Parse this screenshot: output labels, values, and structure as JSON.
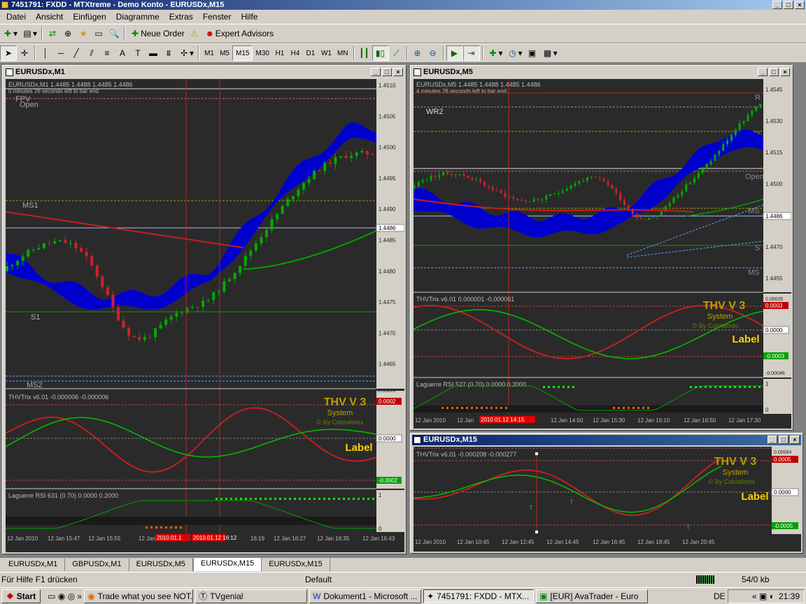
{
  "app": {
    "title": "7451791: FXDD - MTXtreme - Demo Konto - EURUSDx,M15"
  },
  "menu": [
    "Datei",
    "Ansicht",
    "Einfügen",
    "Diagramme",
    "Extras",
    "Fenster",
    "Hilfe"
  ],
  "toolbar1": {
    "new_order": "Neue Order",
    "expert_advisors": "Expert Advisors"
  },
  "timeframes": [
    "M1",
    "M5",
    "M15",
    "M30",
    "H1",
    "H4",
    "D1",
    "W1",
    "MN"
  ],
  "active_timeframe": "M15",
  "colors": {
    "bg": "#2a2a2a",
    "bull": "#00aa00",
    "bear": "#cc2030",
    "cloud": "#0000cc",
    "ma_red": "#c02020",
    "ma_green": "#00a000",
    "thv_title": "#b8a000",
    "label": "#ffd000"
  },
  "windows": {
    "m1": {
      "title": "EURUSDx,M1",
      "header": "EURUSDx,M1  1.4485 1.4488 1.4485 1.4486",
      "timer": "0 minutes 26 seconds left to bar end",
      "levels": [
        "FPV",
        "Open",
        "MS1",
        "S1",
        "MS2"
      ],
      "price_ticks": [
        "1.4510",
        "1.4505",
        "1.4500",
        "1.4495",
        "1.4490",
        "1.4485",
        "1.4480",
        "1.4475",
        "1.4470",
        "1.4465"
      ],
      "current_price": "1.4486",
      "thv_header": "THVTrix v6.01 -0.000006 -0.000006",
      "thv_brand": {
        "title": "THV V 3",
        "system": "System",
        "by": "© By Cobraforex",
        "label": "Label"
      },
      "thv_ticks": [
        "0.0002",
        "0.0000",
        "-0.0002"
      ],
      "thv_scale": "0.00018",
      "rsi_header": "Laguerre RSI 631 (0.70) 0.0000 0.2000",
      "rsi_ticks": [
        "1",
        "0"
      ],
      "time_labels": [
        "12 Jan 2010",
        "12 Jan 15:47",
        "12 Jan 15:55",
        "12 Jan",
        "2010.01.1",
        "2010.01.12 16:12",
        "16:19",
        "12 Jan 16:27",
        "12 Jan 16:35",
        "12 Jan 16:43"
      ]
    },
    "m5": {
      "title": "EURUSDx,M5",
      "header": "EURUSDx,M5  1.4485 1.4488 1.4485 1.4486",
      "timer": "4 minutes 26 seconds left to bar end",
      "levels": [
        "WR2",
        "R",
        "MR",
        "Open",
        "MS",
        "S",
        "MS"
      ],
      "price_ticks": [
        "1.4545",
        "1.4530",
        "1.4515",
        "1.4500",
        "1.4485",
        "1.4470",
        "1.4455"
      ],
      "current_price": "1.4486",
      "thv_header": "THVTrix v6.01 0.000001 -0.000061",
      "thv_brand": {
        "title": "THV V 3",
        "system": "System",
        "by": "© By Cobraforex",
        "label": "Label"
      },
      "thv_ticks": [
        "0.00035",
        "0.0003",
        "0.0000",
        "-0.0003",
        "-0.00046"
      ],
      "rsi_header": "Laguerre RSI 527 (0.70) 0.0000 0.2000",
      "rsi_ticks": [
        "1",
        "0"
      ],
      "time_labels": [
        "12 Jan 2010",
        "12 Jan",
        "2010.01.12 14:15",
        "12 Jan 14:50",
        "12 Jan 15:30",
        "12 Jan 16:10",
        "12 Jan 16:50",
        "12 Jan 17:30"
      ]
    },
    "m15": {
      "title": "EURUSDx,M15",
      "thv_header": "THVTrix v6.01 -0.000208 -0.000277",
      "thv_brand": {
        "title": "THV V 3",
        "system": "System",
        "by": "© By Cobraforex",
        "label": "Label"
      },
      "thv_ticks": [
        "0.00064",
        "0.0005",
        "0.0000",
        "-0.0005"
      ],
      "time_labels": [
        "12 Jan 2010",
        "12 Jan 10:45",
        "12 Jan 12:45",
        "12 Jan 14:45",
        "12 Jan 16:45",
        "12 Jan 18:45",
        "12 Jan 20:45"
      ]
    }
  },
  "tabs": [
    "EURUSDx,M1",
    "GBPUSDx,M1",
    "EURUSDx,M5",
    "EURUSDx,M15",
    "EURUSDx,M15"
  ],
  "active_tab": 3,
  "status": {
    "help": "Für Hilfe F1 drücken",
    "profile": "Default",
    "traffic": "54/0 kb"
  },
  "taskbar": {
    "start": "Start",
    "items": [
      "Trade what you see NOT...",
      "TVgenial",
      "Dokument1 - Microsoft ...",
      "7451791: FXDD - MTX...",
      "[EUR] AvaTrader - Euro"
    ],
    "active": 3,
    "lang": "DE",
    "clock": "21:39"
  }
}
